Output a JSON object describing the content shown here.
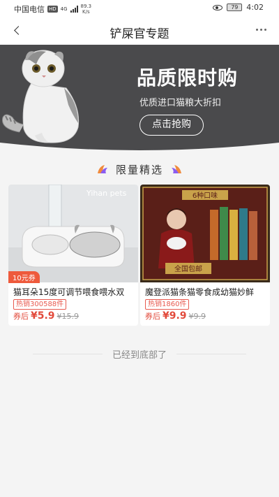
{
  "status_bar": {
    "carrier": "中国电信",
    "hd": "HD",
    "network": "4G",
    "speed_value": "89.3",
    "speed_unit": "K/s",
    "battery": "79",
    "time": "4:02"
  },
  "nav": {
    "title": "铲屎官专题"
  },
  "banner": {
    "title": "品质限时购",
    "subtitle": "优质进口猫粮大折扣",
    "button": "点击抢购"
  },
  "section": {
    "title": "限量精选"
  },
  "products": [
    {
      "image_text": "Yihan pets",
      "coupon": "10元券",
      "name": "猫耳朵15度可调节喂食喂水双",
      "sales": "热销300588件",
      "price_label": "券后",
      "price": "¥5.9",
      "old_price": "¥15.9"
    },
    {
      "image_text_1": "6种口味",
      "image_text_2": "全国包邮",
      "name": "魔登派猫条猫零食成幼猫妙鲜",
      "sales": "热销1860件",
      "price_label": "券后",
      "price": "¥9.9",
      "old_price": "¥9.9"
    }
  ],
  "footer": {
    "end_text": "已经到底部了"
  },
  "colors": {
    "banner_bg": "#4a4a4c",
    "accent": "#e24a3b",
    "coupon": "#ee5a3c"
  }
}
